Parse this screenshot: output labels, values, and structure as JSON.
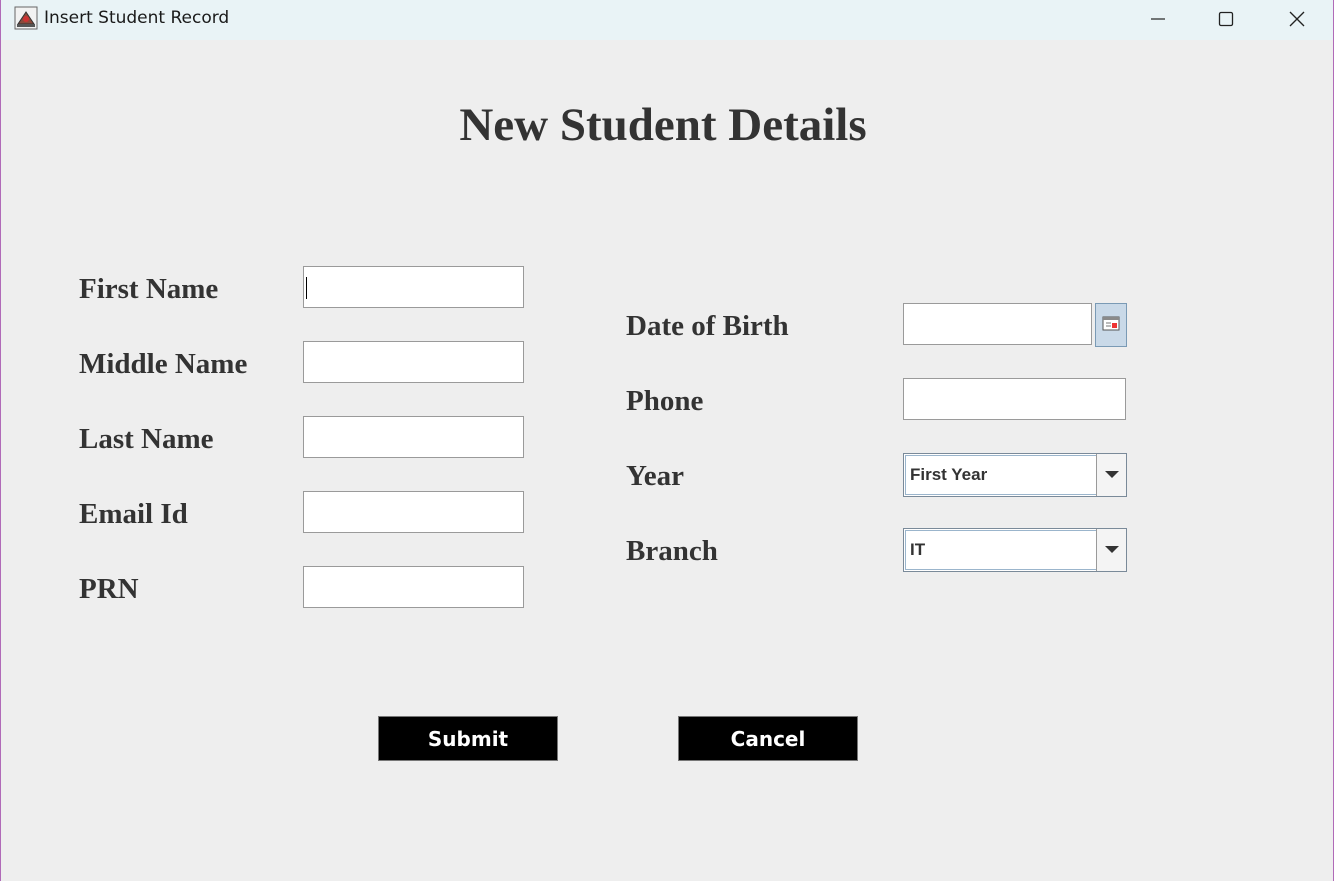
{
  "window": {
    "title": "Insert Student Record",
    "controls": {
      "minimize": "minimize-icon",
      "maximize": "maximize-icon",
      "close": "close-icon"
    }
  },
  "form": {
    "heading": "New Student Details",
    "left": {
      "first_name_label": "First Name",
      "middle_name_label": "Middle Name",
      "last_name_label": "Last Name",
      "email_label": "Email Id",
      "prn_label": "PRN",
      "first_name_value": "",
      "middle_name_value": "",
      "last_name_value": "",
      "email_value": "",
      "prn_value": ""
    },
    "right": {
      "dob_label": "Date of Birth",
      "phone_label": "Phone",
      "year_label": "Year",
      "branch_label": "Branch",
      "dob_value": "",
      "phone_value": "",
      "year_selected": "First Year",
      "branch_selected": "IT"
    },
    "buttons": {
      "submit": "Submit",
      "cancel": "Cancel"
    }
  },
  "colors": {
    "background": "#eeeeee",
    "text": "#333333",
    "button_bg": "#000000",
    "button_text": "#ffffff",
    "titlebar": "#e9f3f6"
  }
}
